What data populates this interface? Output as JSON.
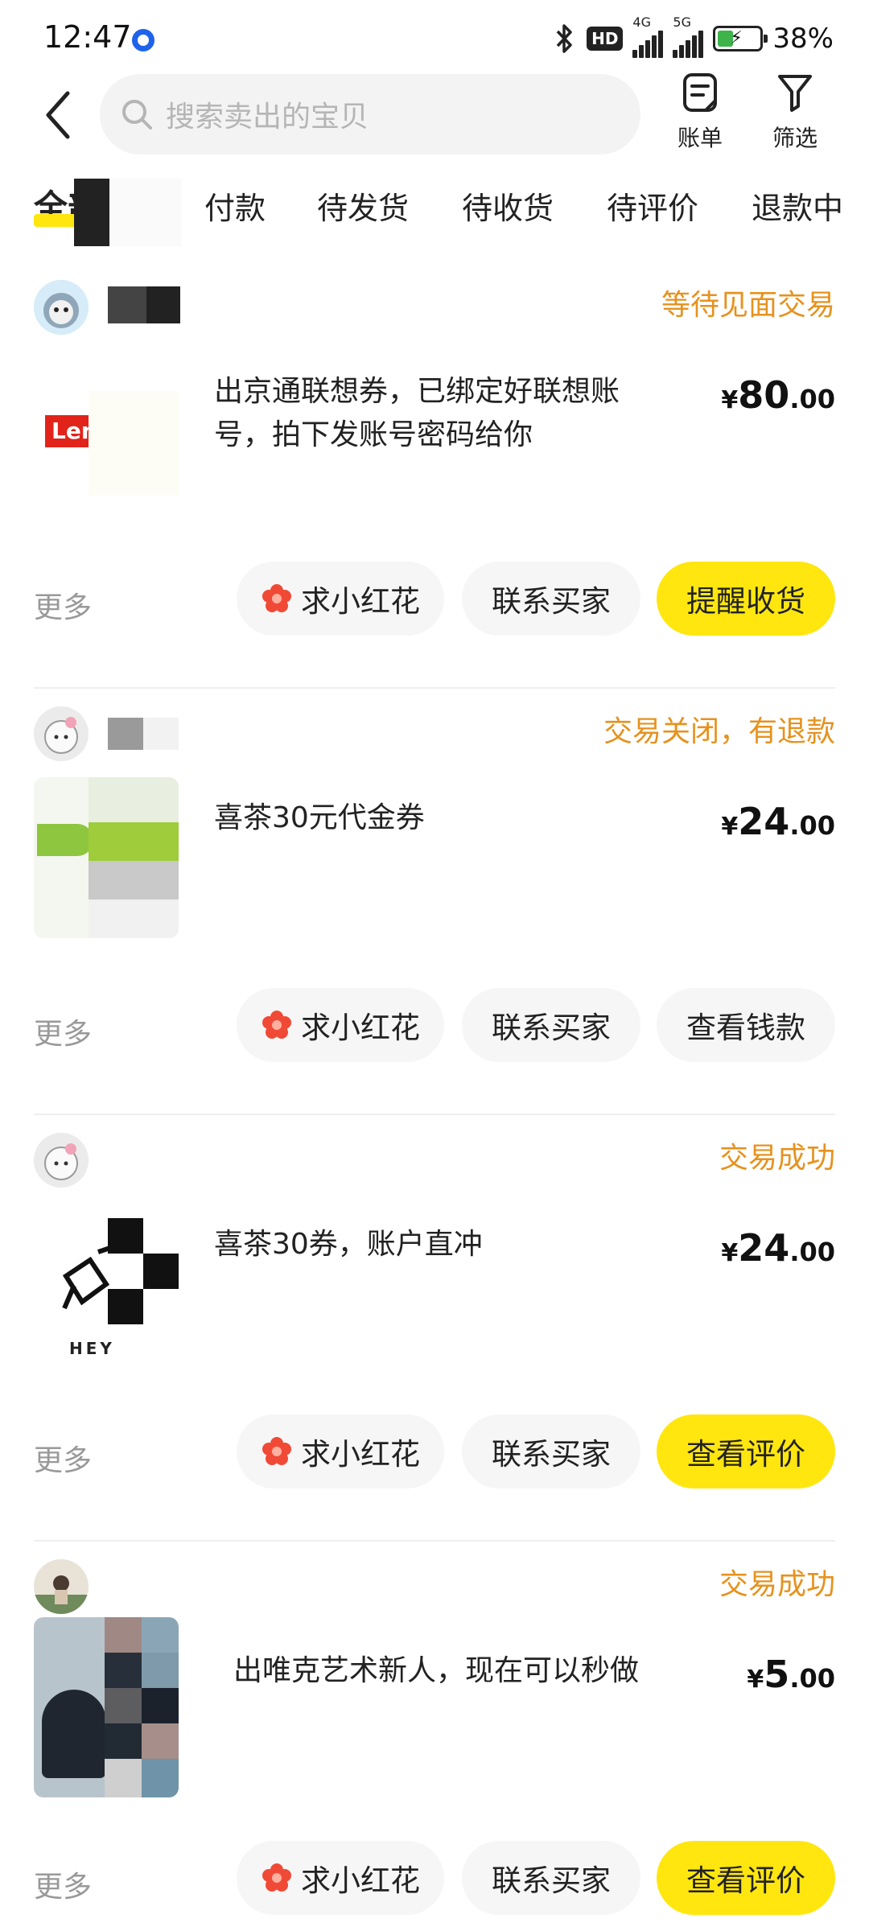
{
  "status_bar": {
    "time": "12:47",
    "hd_badge": "HD",
    "net1": "4G",
    "net2": "5G",
    "battery": "38%",
    "battery_level": 0.38
  },
  "header": {
    "search_placeholder": "搜索卖出的宝贝",
    "bill_label": "账单",
    "filter_label": "筛选"
  },
  "tabs": [
    {
      "label": "全部",
      "active": true
    },
    {
      "label": "付款"
    },
    {
      "label": "待发货"
    },
    {
      "label": "待收货"
    },
    {
      "label": "待评价"
    },
    {
      "label": "退款中"
    }
  ],
  "orders": [
    {
      "status": "等待见面交易",
      "title": "出京通联想券，已绑定好联想账号，拍下发账号密码给你",
      "price_int": "80",
      "price_dec": ".00",
      "thumb_text": "Lenovo",
      "more": "更多",
      "buttons": [
        "求小红花",
        "联系买家",
        "提醒收货"
      ]
    },
    {
      "status": "交易关闭，有退款",
      "title": "喜茶30元代金券",
      "price_int": "24",
      "price_dec": ".00",
      "more": "更多",
      "buttons": [
        "求小红花",
        "联系买家",
        "查看钱款"
      ]
    },
    {
      "status": "交易成功",
      "title": "喜茶30券，账户直冲",
      "price_int": "24",
      "price_dec": ".00",
      "thumb_text": "HEY",
      "more": "更多",
      "buttons": [
        "求小红花",
        "联系买家",
        "查看评价"
      ]
    },
    {
      "status": "交易成功",
      "title": "出唯克艺术新人，现在可以秒做",
      "price_int": "5",
      "price_dec": ".00",
      "more": "更多",
      "buttons": [
        "求小红花",
        "联系买家",
        "查看评价"
      ]
    }
  ],
  "price_symbol": "¥",
  "colors": {
    "accent_yellow": "#ffe60f",
    "status_orange": "#e6921e",
    "flower_red": "#f04a36"
  }
}
